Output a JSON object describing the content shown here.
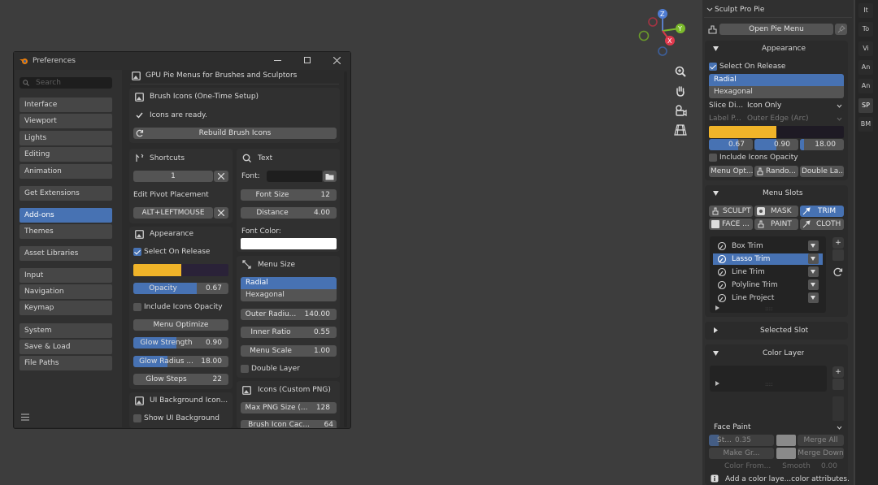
{
  "colors": {
    "accent": "#4772b3",
    "yellow": "#f0b429",
    "bg": "#3d3d3d",
    "panel": "#2b2b2b"
  },
  "prefs": {
    "title": "Preferences",
    "search_placeholder": "Search",
    "nav": [
      "Interface",
      "Viewport",
      "Lights",
      "Editing",
      "Animation",
      "Get Extensions",
      "Add-ons",
      "Themes",
      "Asset Libraries",
      "Input",
      "Navigation",
      "Keymap",
      "System",
      "Save & Load",
      "File Paths"
    ],
    "header": "GPU Pie Menus for Brushes and Sculptors",
    "brush_icons": {
      "title": "Brush Icons (One-Time Setup)",
      "status": "Icons are ready.",
      "rebuild": "Rebuild Brush Icons"
    },
    "shortcuts": {
      "title": "Shortcuts",
      "value": "1",
      "edit_pivot": "Edit Pivot Placement",
      "pivot_key": "ALT+LEFTMOUSE"
    },
    "appearance": {
      "title": "Appearance",
      "select_on_release": "Select On Release",
      "opacity_label": "Opacity",
      "opacity_value": "0.67",
      "opacity_fill": 0.67,
      "color_fill": 0.5,
      "include_icons_opacity": "Include Icons Opacity",
      "menu_optimize": "Menu Optimize",
      "glow_strength_label": "Glow Strength",
      "glow_strength_value": "0.90",
      "glow_strength_fill": 0.45,
      "glow_radius_label": "Glow Radius ...",
      "glow_radius_value": "18.00",
      "glow_radius_fill": 0.36,
      "glow_steps_label": "Glow Steps",
      "glow_steps_value": "22"
    },
    "ui_bg": {
      "title": "UI Background Icon...",
      "show": "Show UI Background"
    },
    "text": {
      "title": "Text",
      "font_label": "Font:",
      "font_size_label": "Font Size",
      "font_size_value": "12",
      "distance_label": "Distance",
      "distance_value": "4.00",
      "font_color_label": "Font Color:"
    },
    "menu_size": {
      "title": "Menu Size",
      "radial": "Radial",
      "hexagonal": "Hexagonal",
      "outer_radius_label": "Outer Radiu...",
      "outer_radius_value": "140.00",
      "inner_ratio_label": "Inner Ratio",
      "inner_ratio_value": "0.55",
      "menu_scale_label": "Menu Scale",
      "menu_scale_value": "1.00",
      "double_layer": "Double Layer"
    },
    "icons_custom": {
      "title": "Icons (Custom PNG)",
      "max_png_label": "Max PNG Size (...",
      "max_png_value": "128",
      "brush_icon_cache_label": "Brush Icon Cac...",
      "brush_icon_cache_value": "64"
    }
  },
  "viewport": {
    "axes": {
      "x": "X",
      "y": "Y",
      "z": "Z"
    }
  },
  "tabs": [
    "It",
    "To",
    "Vi",
    "An",
    "An",
    "SP",
    "BM"
  ],
  "sidebar": {
    "title": "Sculpt Pro Pie",
    "open_pie": "Open Pie Menu",
    "appearance": {
      "title": "Appearance",
      "select_on_release": "Select On Release",
      "radial": "Radial",
      "hexagonal": "Hexagonal",
      "slice_label": "Slice Di...",
      "slice_value": "Icon Only",
      "label_label": "Label P...",
      "label_value": "Outer Edge (Arc)",
      "opacity_value": "0.67",
      "opacity_fill": 0.67,
      "glow_strength_value": "0.90",
      "glow_strength_fill": 0.5,
      "glow_radius_value": "18.00",
      "glow_radius_fill": 0.09,
      "include_icons_opacity": "Include Icons Opacity",
      "menu_opt": "Menu Opt...",
      "random": "Rando...",
      "double_layer": "Double La..."
    },
    "menu_slots": {
      "title": "Menu Slots",
      "modes": [
        "SCULPT",
        "MASK",
        "TRIM",
        "FACE ...",
        "PAINT",
        "CLOTH"
      ],
      "items": [
        "Box Trim",
        "Lasso Trim",
        "Line Trim",
        "Polyline Trim",
        "Line Project"
      ],
      "add": "+",
      "dots": "::::"
    },
    "selected_slot": {
      "title": "Selected Slot"
    },
    "color_layer": {
      "title": "Color Layer",
      "add": "+",
      "dots": "::::",
      "face_paint": "Face Paint",
      "str_label": "St...",
      "str_value": "0.35",
      "merge_all": "Merge All",
      "make_group": "Make Gr...",
      "merge_down": "Merge Down",
      "color_from": "Color From...",
      "smooth_label": "Smooth",
      "smooth_value": "0.00",
      "info": "Add a color laye...color attributes."
    }
  }
}
